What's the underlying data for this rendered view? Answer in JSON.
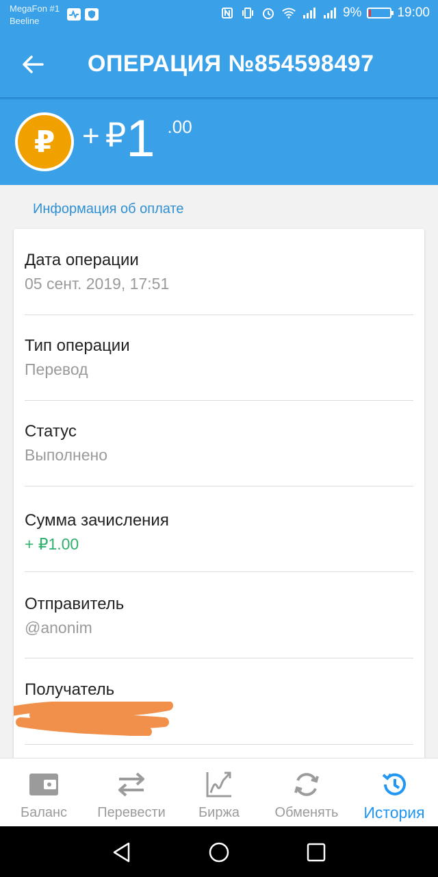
{
  "status_bar": {
    "carrier1": "MegaFon #1",
    "carrier2": "Beeline",
    "battery_text": "9%",
    "battery_level": 0.09,
    "time": "19:00"
  },
  "app_bar": {
    "title": "ОПЕРАЦИЯ №854598497"
  },
  "amount_header": {
    "coin_symbol": "₽",
    "sign": "+",
    "currency": "₽",
    "integer": "1",
    "decimal": ".00"
  },
  "section_label": "Информация об оплате",
  "details": [
    {
      "label": "Дата операции",
      "value": "05 сент. 2019, 17:51"
    },
    {
      "label": "Тип операции",
      "value": "Перевод"
    },
    {
      "label": "Статус",
      "value": "Выполнено"
    },
    {
      "label": "Сумма зачисления",
      "value": "+ ₽1.00"
    },
    {
      "label": "Отправитель",
      "value": "@anonim"
    },
    {
      "label": "Получатель",
      "value": ""
    }
  ],
  "colors": {
    "primary": "#3aa0e8",
    "accent": "#2196f3",
    "coin": "#f0a100",
    "positive": "#2fb06b",
    "redaction": "#f0904a"
  },
  "bottom_nav": [
    {
      "label": "Баланс",
      "icon": "wallet-icon",
      "active": false
    },
    {
      "label": "Перевести",
      "icon": "transfer-icon",
      "active": false
    },
    {
      "label": "Биржа",
      "icon": "chart-icon",
      "active": false
    },
    {
      "label": "Обменять",
      "icon": "refresh-icon",
      "active": false
    },
    {
      "label": "История",
      "icon": "history-icon",
      "active": true
    }
  ]
}
